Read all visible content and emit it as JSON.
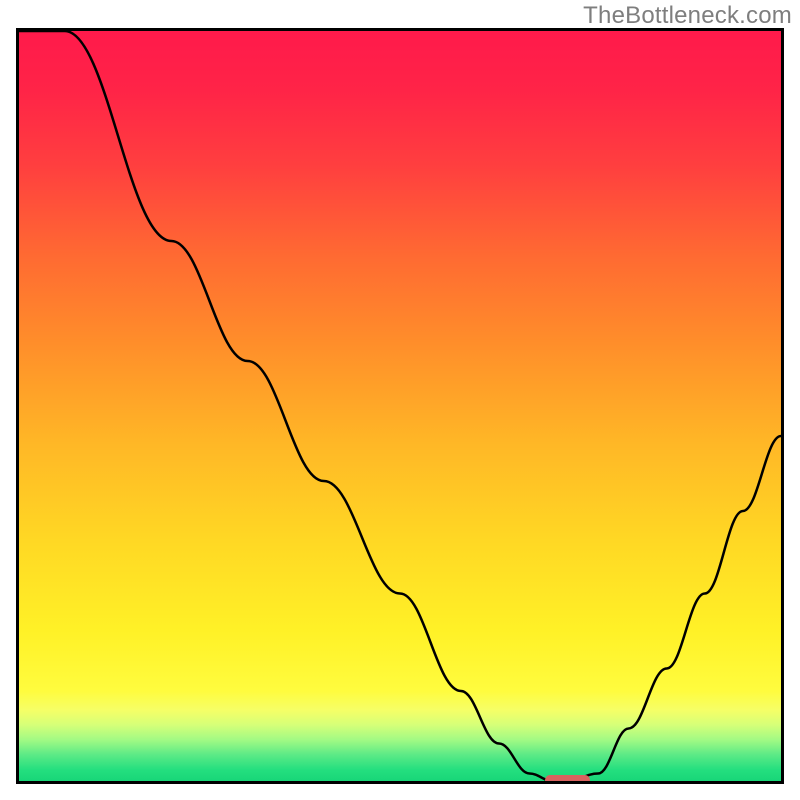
{
  "watermark": "TheBottleneck.com",
  "colors": {
    "border": "#000000",
    "curve": "#000000",
    "marker": "#d9625f"
  },
  "gradient_stops": [
    {
      "offset": 0.0,
      "color": "#ff1a4b"
    },
    {
      "offset": 0.08,
      "color": "#ff2447"
    },
    {
      "offset": 0.18,
      "color": "#ff3f3f"
    },
    {
      "offset": 0.3,
      "color": "#ff6a32"
    },
    {
      "offset": 0.42,
      "color": "#ff8f2a"
    },
    {
      "offset": 0.55,
      "color": "#ffb726"
    },
    {
      "offset": 0.68,
      "color": "#ffd824"
    },
    {
      "offset": 0.8,
      "color": "#fff127"
    },
    {
      "offset": 0.88,
      "color": "#fffc3e"
    },
    {
      "offset": 0.905,
      "color": "#f6ff66"
    },
    {
      "offset": 0.925,
      "color": "#d6ff78"
    },
    {
      "offset": 0.945,
      "color": "#a2fa84"
    },
    {
      "offset": 0.965,
      "color": "#5cea86"
    },
    {
      "offset": 0.985,
      "color": "#24df7f"
    },
    {
      "offset": 1.0,
      "color": "#18d678"
    }
  ],
  "chart_data": {
    "type": "line",
    "title": "",
    "xlabel": "",
    "ylabel": "",
    "xlim": [
      0,
      100
    ],
    "ylim": [
      0,
      100
    ],
    "x": [
      0,
      6,
      20,
      30,
      40,
      50,
      58,
      63,
      67,
      70,
      72,
      76,
      80,
      85,
      90,
      95,
      100
    ],
    "values": [
      100,
      100,
      72,
      56,
      40,
      25,
      12,
      5,
      1,
      0,
      0,
      1,
      7,
      15,
      25,
      36,
      46
    ],
    "marker": {
      "x_start": 69,
      "x_end": 75,
      "y": 0.2
    }
  }
}
